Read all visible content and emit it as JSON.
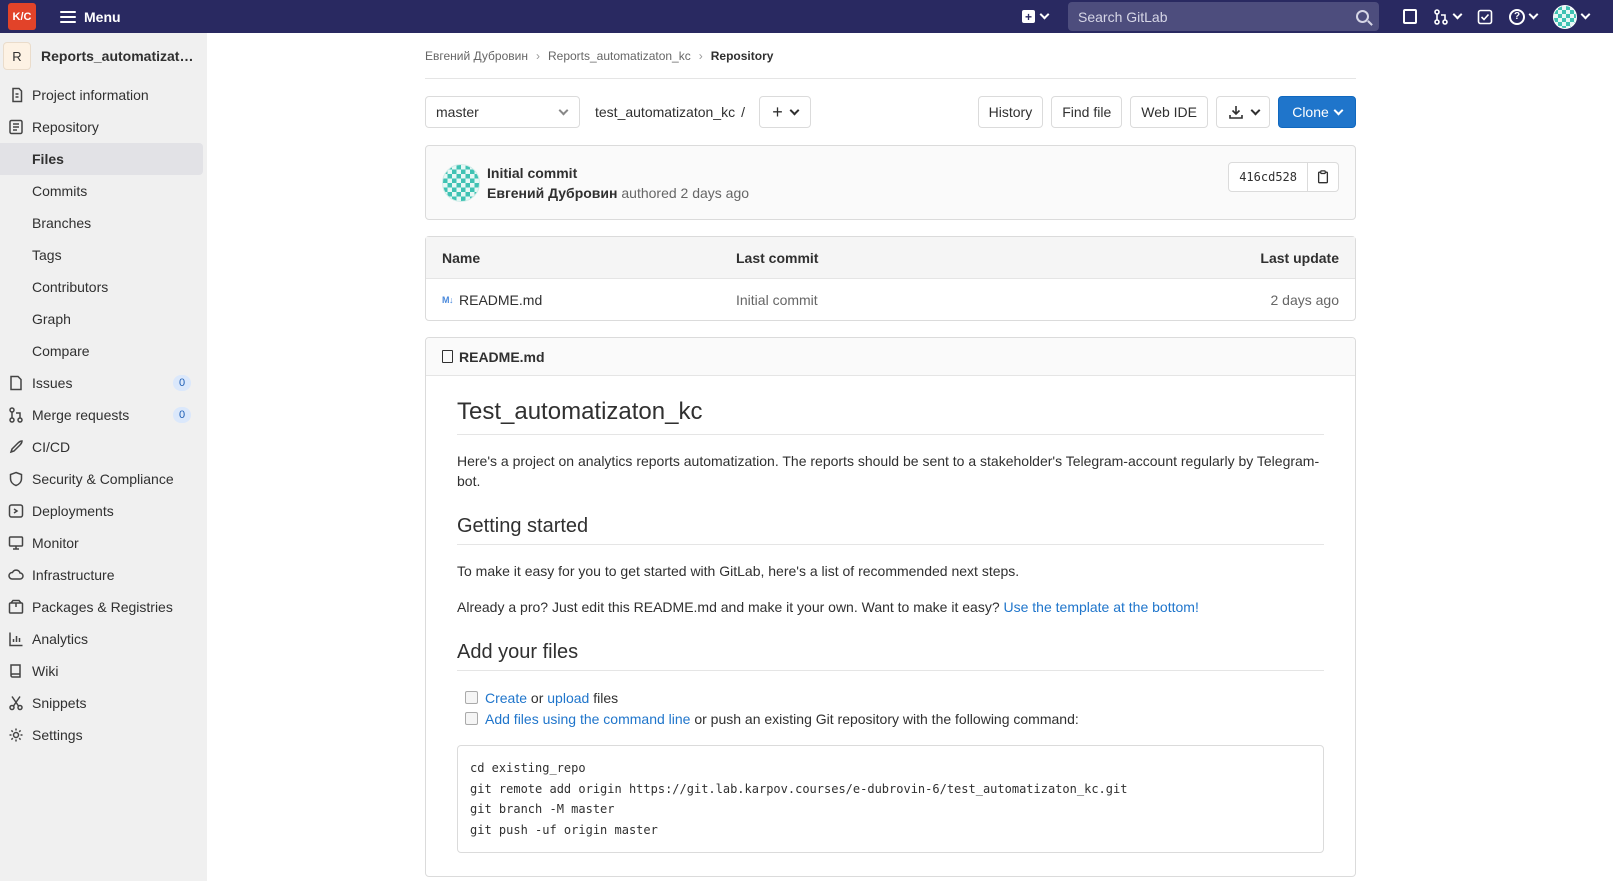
{
  "topbar": {
    "logo_text": "K/C",
    "menu_label": "Menu",
    "search_placeholder": "Search GitLab"
  },
  "sidebar": {
    "project_initial": "R",
    "project_name": "Reports_automatizaton...",
    "items": [
      {
        "label": "Project information",
        "icon": "info-icon"
      },
      {
        "label": "Repository",
        "icon": "repository-icon"
      },
      {
        "label": "Files",
        "sub": true,
        "active": true
      },
      {
        "label": "Commits",
        "sub": true
      },
      {
        "label": "Branches",
        "sub": true
      },
      {
        "label": "Tags",
        "sub": true
      },
      {
        "label": "Contributors",
        "sub": true
      },
      {
        "label": "Graph",
        "sub": true
      },
      {
        "label": "Compare",
        "sub": true
      },
      {
        "label": "Issues",
        "icon": "issues-icon",
        "badge": "0"
      },
      {
        "label": "Merge requests",
        "icon": "merge-request-icon",
        "badge": "0"
      },
      {
        "label": "CI/CD",
        "icon": "rocket-icon"
      },
      {
        "label": "Security & Compliance",
        "icon": "shield-icon"
      },
      {
        "label": "Deployments",
        "icon": "deployments-icon"
      },
      {
        "label": "Monitor",
        "icon": "monitor-icon"
      },
      {
        "label": "Infrastructure",
        "icon": "cloud-icon"
      },
      {
        "label": "Packages & Registries",
        "icon": "package-icon"
      },
      {
        "label": "Analytics",
        "icon": "chart-icon"
      },
      {
        "label": "Wiki",
        "icon": "book-icon"
      },
      {
        "label": "Snippets",
        "icon": "scissors-icon"
      },
      {
        "label": "Settings",
        "icon": "gear-icon"
      }
    ]
  },
  "breadcrumb": {
    "user": "Евгений Дубровин",
    "project": "Reports_automatizaton_kc",
    "current": "Repository"
  },
  "toolbar": {
    "branch": "master",
    "path": "test_automatizaton_kc",
    "path_sep": "/",
    "history": "History",
    "find_file": "Find file",
    "web_ide": "Web IDE",
    "clone": "Clone"
  },
  "commit": {
    "title": "Initial commit",
    "author": "Евгений Дубровин",
    "meta": "authored 2 days ago",
    "sha": "416cd528"
  },
  "file_table": {
    "headers": {
      "name": "Name",
      "last_commit": "Last commit",
      "last_update": "Last update"
    },
    "rows": [
      {
        "icon_text": "M↓",
        "name": "README.md",
        "last_commit": "Initial commit",
        "last_update": "2 days ago"
      }
    ]
  },
  "readme": {
    "filename": "README.md",
    "h1": "Test_automatizaton_kc",
    "intro": "Here's a project on analytics reports automatization. The reports should be sent to a stakeholder's Telegram-account regularly by Telegram-bot.",
    "h2_getting_started": "Getting started",
    "p_easy": "To make it easy for you to get started with GitLab, here's a list of recommended next steps.",
    "p_pro_text": "Already a pro? Just edit this README.md and make it your own. Want to make it easy?",
    "p_pro_link": "Use the template at the bottom!",
    "h2_add_files": "Add your files",
    "task1_link1": "Create",
    "task1_or": "or",
    "task1_link2": "upload",
    "task1_rest": "files",
    "task2_link": "Add files using the command line",
    "task2_rest": "or push an existing Git repository with the following command:",
    "code": "cd existing_repo\ngit remote add origin https://git.lab.karpov.courses/e-dubrovin-6/test_automatizaton_kc.git\ngit branch -M master\ngit push -uf origin master"
  }
}
